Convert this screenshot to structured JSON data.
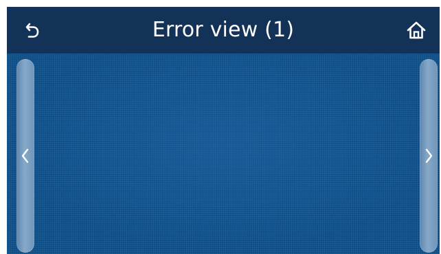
{
  "header": {
    "title": "Error view (1)",
    "back_icon": "back-arrow-icon",
    "home_icon": "home-icon"
  },
  "navigation": {
    "prev_icon": "chevron-left-icon",
    "next_icon": "chevron-right-icon"
  },
  "colors": {
    "header_bg": "#133257",
    "content_bg": "#0d4e87",
    "scrollbar": "#7a9fc2",
    "text": "#ffffff"
  }
}
